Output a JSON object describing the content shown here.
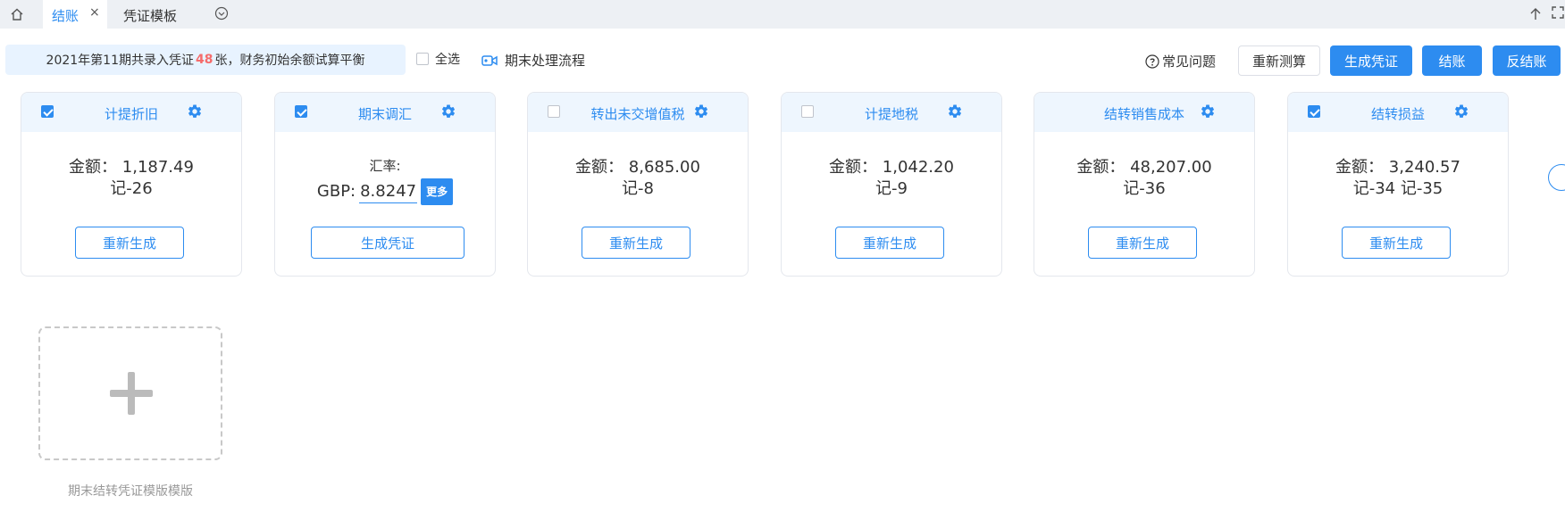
{
  "tabs": {
    "active_label": "结账",
    "close_glyph": "×",
    "second_label": "凭证模板"
  },
  "toolbar": {
    "info_prefix": "2021年第11期共录入凭证",
    "info_count": "48",
    "info_suffix": "张，财务初始余额试算平衡",
    "select_all": "全选",
    "flow_label": "期末处理流程",
    "help_label": "常见问题",
    "retest_label": "重新测算",
    "generate_label": "生成凭证",
    "close_label": "结账",
    "reverse_label": "反结账"
  },
  "cards": [
    {
      "title": "计提折旧",
      "checked": true,
      "amount_label": "金额：",
      "amount": "1,187.49",
      "ref": "记-26",
      "button": "重新生成"
    },
    {
      "title": "期末调汇",
      "checked": true,
      "fx_label": "汇率:",
      "currency": "GBP:",
      "rate": "8.8247",
      "more": "更多",
      "button": "生成凭证"
    },
    {
      "title": "转出未交增值税",
      "checked": false,
      "amount_label": "金额：",
      "amount": "8,685.00",
      "ref": "记-8",
      "button": "重新生成"
    },
    {
      "title": "计提地税",
      "checked": false,
      "amount_label": "金额：",
      "amount": "1,042.20",
      "ref": "记-9",
      "button": "重新生成"
    },
    {
      "title": "结转销售成本",
      "checked": false,
      "amount_label": "金额：",
      "amount": "48,207.00",
      "ref": "记-36",
      "button": "重新生成"
    },
    {
      "title": "结转损益",
      "checked": true,
      "amount_label": "金额：",
      "amount": "3,240.57",
      "ref": "记-34 记-35",
      "button": "重新生成"
    }
  ],
  "template": {
    "add_label": "期末结转凭证模版模版"
  },
  "colors": {
    "accent": "#2d8cf0",
    "info_bg": "#e8f3ff",
    "card_header_bg": "#eef6fe",
    "count_red": "#f56c6c"
  },
  "icons": {
    "home": "home-icon",
    "close": "close-icon",
    "tab_more": "chevron-down-circle-icon",
    "arrow_up": "arrow-up-icon",
    "fullscreen": "fullscreen-icon",
    "video": "video-camera-icon",
    "help": "question-circle-icon",
    "gear": "gear-icon",
    "plus": "plus-icon"
  }
}
